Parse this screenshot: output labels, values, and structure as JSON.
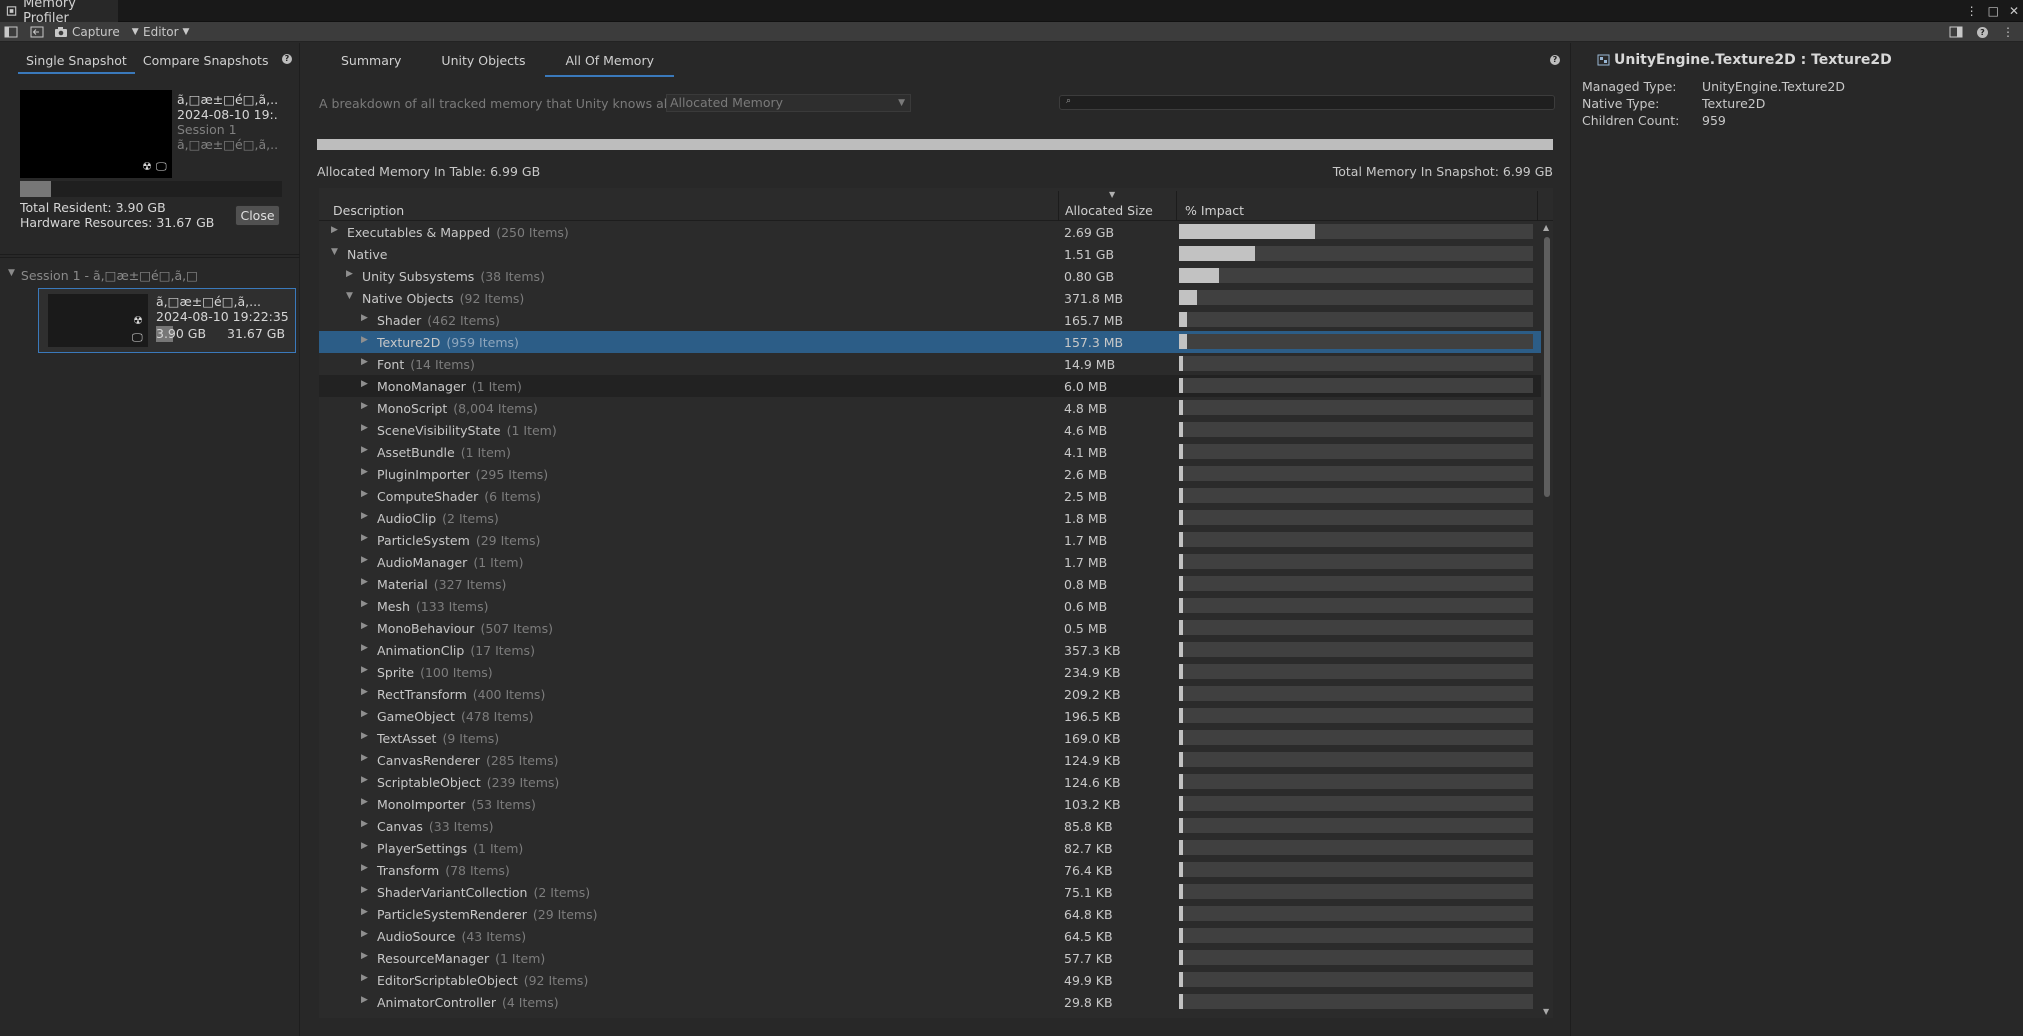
{
  "window": {
    "title": "Memory Profiler",
    "controls": [
      "⋮",
      "□",
      "✕"
    ]
  },
  "toolbar": {
    "capture_label": "Capture",
    "target_label": "Editor"
  },
  "left": {
    "tabs": [
      "Single Snapshot",
      "Compare Snapshots"
    ],
    "snapshot": {
      "name": "ã,□æ±□é□,ã,...",
      "date": "2024-08-10 19:...",
      "session": "Session 1",
      "product": "ã,□æ±□é□,ã,...",
      "total_resident": "Total Resident: 3.90 GB",
      "hardware_resources": "Hardware Resources: 31.67 GB",
      "resident_fraction": 0.12
    },
    "close_label": "Close",
    "session_title": "Session 1 - ã,□æ±□é□,ã,□",
    "session_item": {
      "name": "ã,□æ±□é□,ã,...",
      "date": "2024-08-10 19:22:35",
      "resident": "3.90 GB",
      "hardware": "31.67 GB"
    }
  },
  "main": {
    "tabs": [
      "Summary",
      "Unity Objects",
      "All Of Memory"
    ],
    "active_tab": "All Of Memory",
    "breakdown_text": "A breakdown of all tracked memory that Unity knows about.",
    "dropdown_value": "Allocated Memory",
    "search_placeholder": "",
    "allocated_in_table": "Allocated Memory In Table: 6.99 GB",
    "total_in_snapshot": "Total Memory In Snapshot: 6.99 GB",
    "columns": {
      "description": "Description",
      "size": "Allocated Size",
      "impact": "% Impact"
    },
    "rows": [
      {
        "name": "Executables & Mapped",
        "count": "(250 Items)",
        "size": "2.69 GB",
        "impact": 0.385,
        "depth": 0,
        "expanded": false
      },
      {
        "name": "Native",
        "count": "",
        "size": "1.51 GB",
        "impact": 0.216,
        "depth": 0,
        "expanded": true
      },
      {
        "name": "Unity Subsystems",
        "count": "(38 Items)",
        "size": "0.80 GB",
        "impact": 0.114,
        "depth": 1,
        "expanded": false
      },
      {
        "name": "Native Objects",
        "count": "(92 Items)",
        "size": "371.8 MB",
        "impact": 0.052,
        "depth": 1,
        "expanded": true
      },
      {
        "name": "Shader",
        "count": "(462 Items)",
        "size": "165.7 MB",
        "impact": 0.023,
        "depth": 2,
        "expanded": false
      },
      {
        "name": "Texture2D",
        "count": "(959 Items)",
        "size": "157.3 MB",
        "impact": 0.022,
        "depth": 2,
        "expanded": false,
        "selected": true
      },
      {
        "name": "Font",
        "count": "(14 Items)",
        "size": "14.9 MB",
        "impact": 0.012,
        "depth": 2,
        "expanded": false
      },
      {
        "name": "MonoManager",
        "count": "(1 Item)",
        "size": "6.0 MB",
        "impact": 0.012,
        "depth": 2,
        "expanded": false,
        "alt": true
      },
      {
        "name": "MonoScript",
        "count": "(8,004 Items)",
        "size": "4.8 MB",
        "impact": 0.012,
        "depth": 2,
        "expanded": false
      },
      {
        "name": "SceneVisibilityState",
        "count": "(1 Item)",
        "size": "4.6 MB",
        "impact": 0.012,
        "depth": 2,
        "expanded": false
      },
      {
        "name": "AssetBundle",
        "count": "(1 Item)",
        "size": "4.1 MB",
        "impact": 0.012,
        "depth": 2,
        "expanded": false
      },
      {
        "name": "PluginImporter",
        "count": "(295 Items)",
        "size": "2.6 MB",
        "impact": 0.012,
        "depth": 2,
        "expanded": false
      },
      {
        "name": "ComputeShader",
        "count": "(6 Items)",
        "size": "2.5 MB",
        "impact": 0.012,
        "depth": 2,
        "expanded": false
      },
      {
        "name": "AudioClip",
        "count": "(2 Items)",
        "size": "1.8 MB",
        "impact": 0.012,
        "depth": 2,
        "expanded": false
      },
      {
        "name": "ParticleSystem",
        "count": "(29 Items)",
        "size": "1.7 MB",
        "impact": 0.012,
        "depth": 2,
        "expanded": false
      },
      {
        "name": "AudioManager",
        "count": "(1 Item)",
        "size": "1.7 MB",
        "impact": 0.012,
        "depth": 2,
        "expanded": false
      },
      {
        "name": "Material",
        "count": "(327 Items)",
        "size": "0.8 MB",
        "impact": 0.012,
        "depth": 2,
        "expanded": false
      },
      {
        "name": "Mesh",
        "count": "(133 Items)",
        "size": "0.6 MB",
        "impact": 0.012,
        "depth": 2,
        "expanded": false
      },
      {
        "name": "MonoBehaviour",
        "count": "(507 Items)",
        "size": "0.5 MB",
        "impact": 0.012,
        "depth": 2,
        "expanded": false
      },
      {
        "name": "AnimationClip",
        "count": "(17 Items)",
        "size": "357.3 KB",
        "impact": 0.012,
        "depth": 2,
        "expanded": false
      },
      {
        "name": "Sprite",
        "count": "(100 Items)",
        "size": "234.9 KB",
        "impact": 0.012,
        "depth": 2,
        "expanded": false
      },
      {
        "name": "RectTransform",
        "count": "(400 Items)",
        "size": "209.2 KB",
        "impact": 0.012,
        "depth": 2,
        "expanded": false
      },
      {
        "name": "GameObject",
        "count": "(478 Items)",
        "size": "196.5 KB",
        "impact": 0.012,
        "depth": 2,
        "expanded": false
      },
      {
        "name": "TextAsset",
        "count": "(9 Items)",
        "size": "169.0 KB",
        "impact": 0.012,
        "depth": 2,
        "expanded": false
      },
      {
        "name": "CanvasRenderer",
        "count": "(285 Items)",
        "size": "124.9 KB",
        "impact": 0.012,
        "depth": 2,
        "expanded": false
      },
      {
        "name": "ScriptableObject",
        "count": "(239 Items)",
        "size": "124.6 KB",
        "impact": 0.012,
        "depth": 2,
        "expanded": false
      },
      {
        "name": "MonoImporter",
        "count": "(53 Items)",
        "size": "103.2 KB",
        "impact": 0.012,
        "depth": 2,
        "expanded": false
      },
      {
        "name": "Canvas",
        "count": "(33 Items)",
        "size": "85.8 KB",
        "impact": 0.012,
        "depth": 2,
        "expanded": false
      },
      {
        "name": "PlayerSettings",
        "count": "(1 Item)",
        "size": "82.7 KB",
        "impact": 0.012,
        "depth": 2,
        "expanded": false
      },
      {
        "name": "Transform",
        "count": "(78 Items)",
        "size": "76.4 KB",
        "impact": 0.012,
        "depth": 2,
        "expanded": false
      },
      {
        "name": "ShaderVariantCollection",
        "count": "(2 Items)",
        "size": "75.1 KB",
        "impact": 0.012,
        "depth": 2,
        "expanded": false
      },
      {
        "name": "ParticleSystemRenderer",
        "count": "(29 Items)",
        "size": "64.8 KB",
        "impact": 0.012,
        "depth": 2,
        "expanded": false
      },
      {
        "name": "AudioSource",
        "count": "(43 Items)",
        "size": "64.5 KB",
        "impact": 0.012,
        "depth": 2,
        "expanded": false
      },
      {
        "name": "ResourceManager",
        "count": "(1 Item)",
        "size": "57.7 KB",
        "impact": 0.012,
        "depth": 2,
        "expanded": false
      },
      {
        "name": "EditorScriptableObject",
        "count": "(92 Items)",
        "size": "49.9 KB",
        "impact": 0.012,
        "depth": 2,
        "expanded": false
      },
      {
        "name": "AnimatorController",
        "count": "(4 Items)",
        "size": "29.8 KB",
        "impact": 0.012,
        "depth": 2,
        "expanded": false
      }
    ]
  },
  "details": {
    "title": "UnityEngine.Texture2D : Texture2D",
    "fields": [
      {
        "key": "Managed Type:",
        "value": "UnityEngine.Texture2D"
      },
      {
        "key": "Native Type:",
        "value": "Texture2D"
      },
      {
        "key": "Children Count:",
        "value": "959"
      }
    ]
  },
  "colors": {
    "accent": "#3a79bb",
    "selection": "#2c5d87",
    "background": "#282828"
  }
}
